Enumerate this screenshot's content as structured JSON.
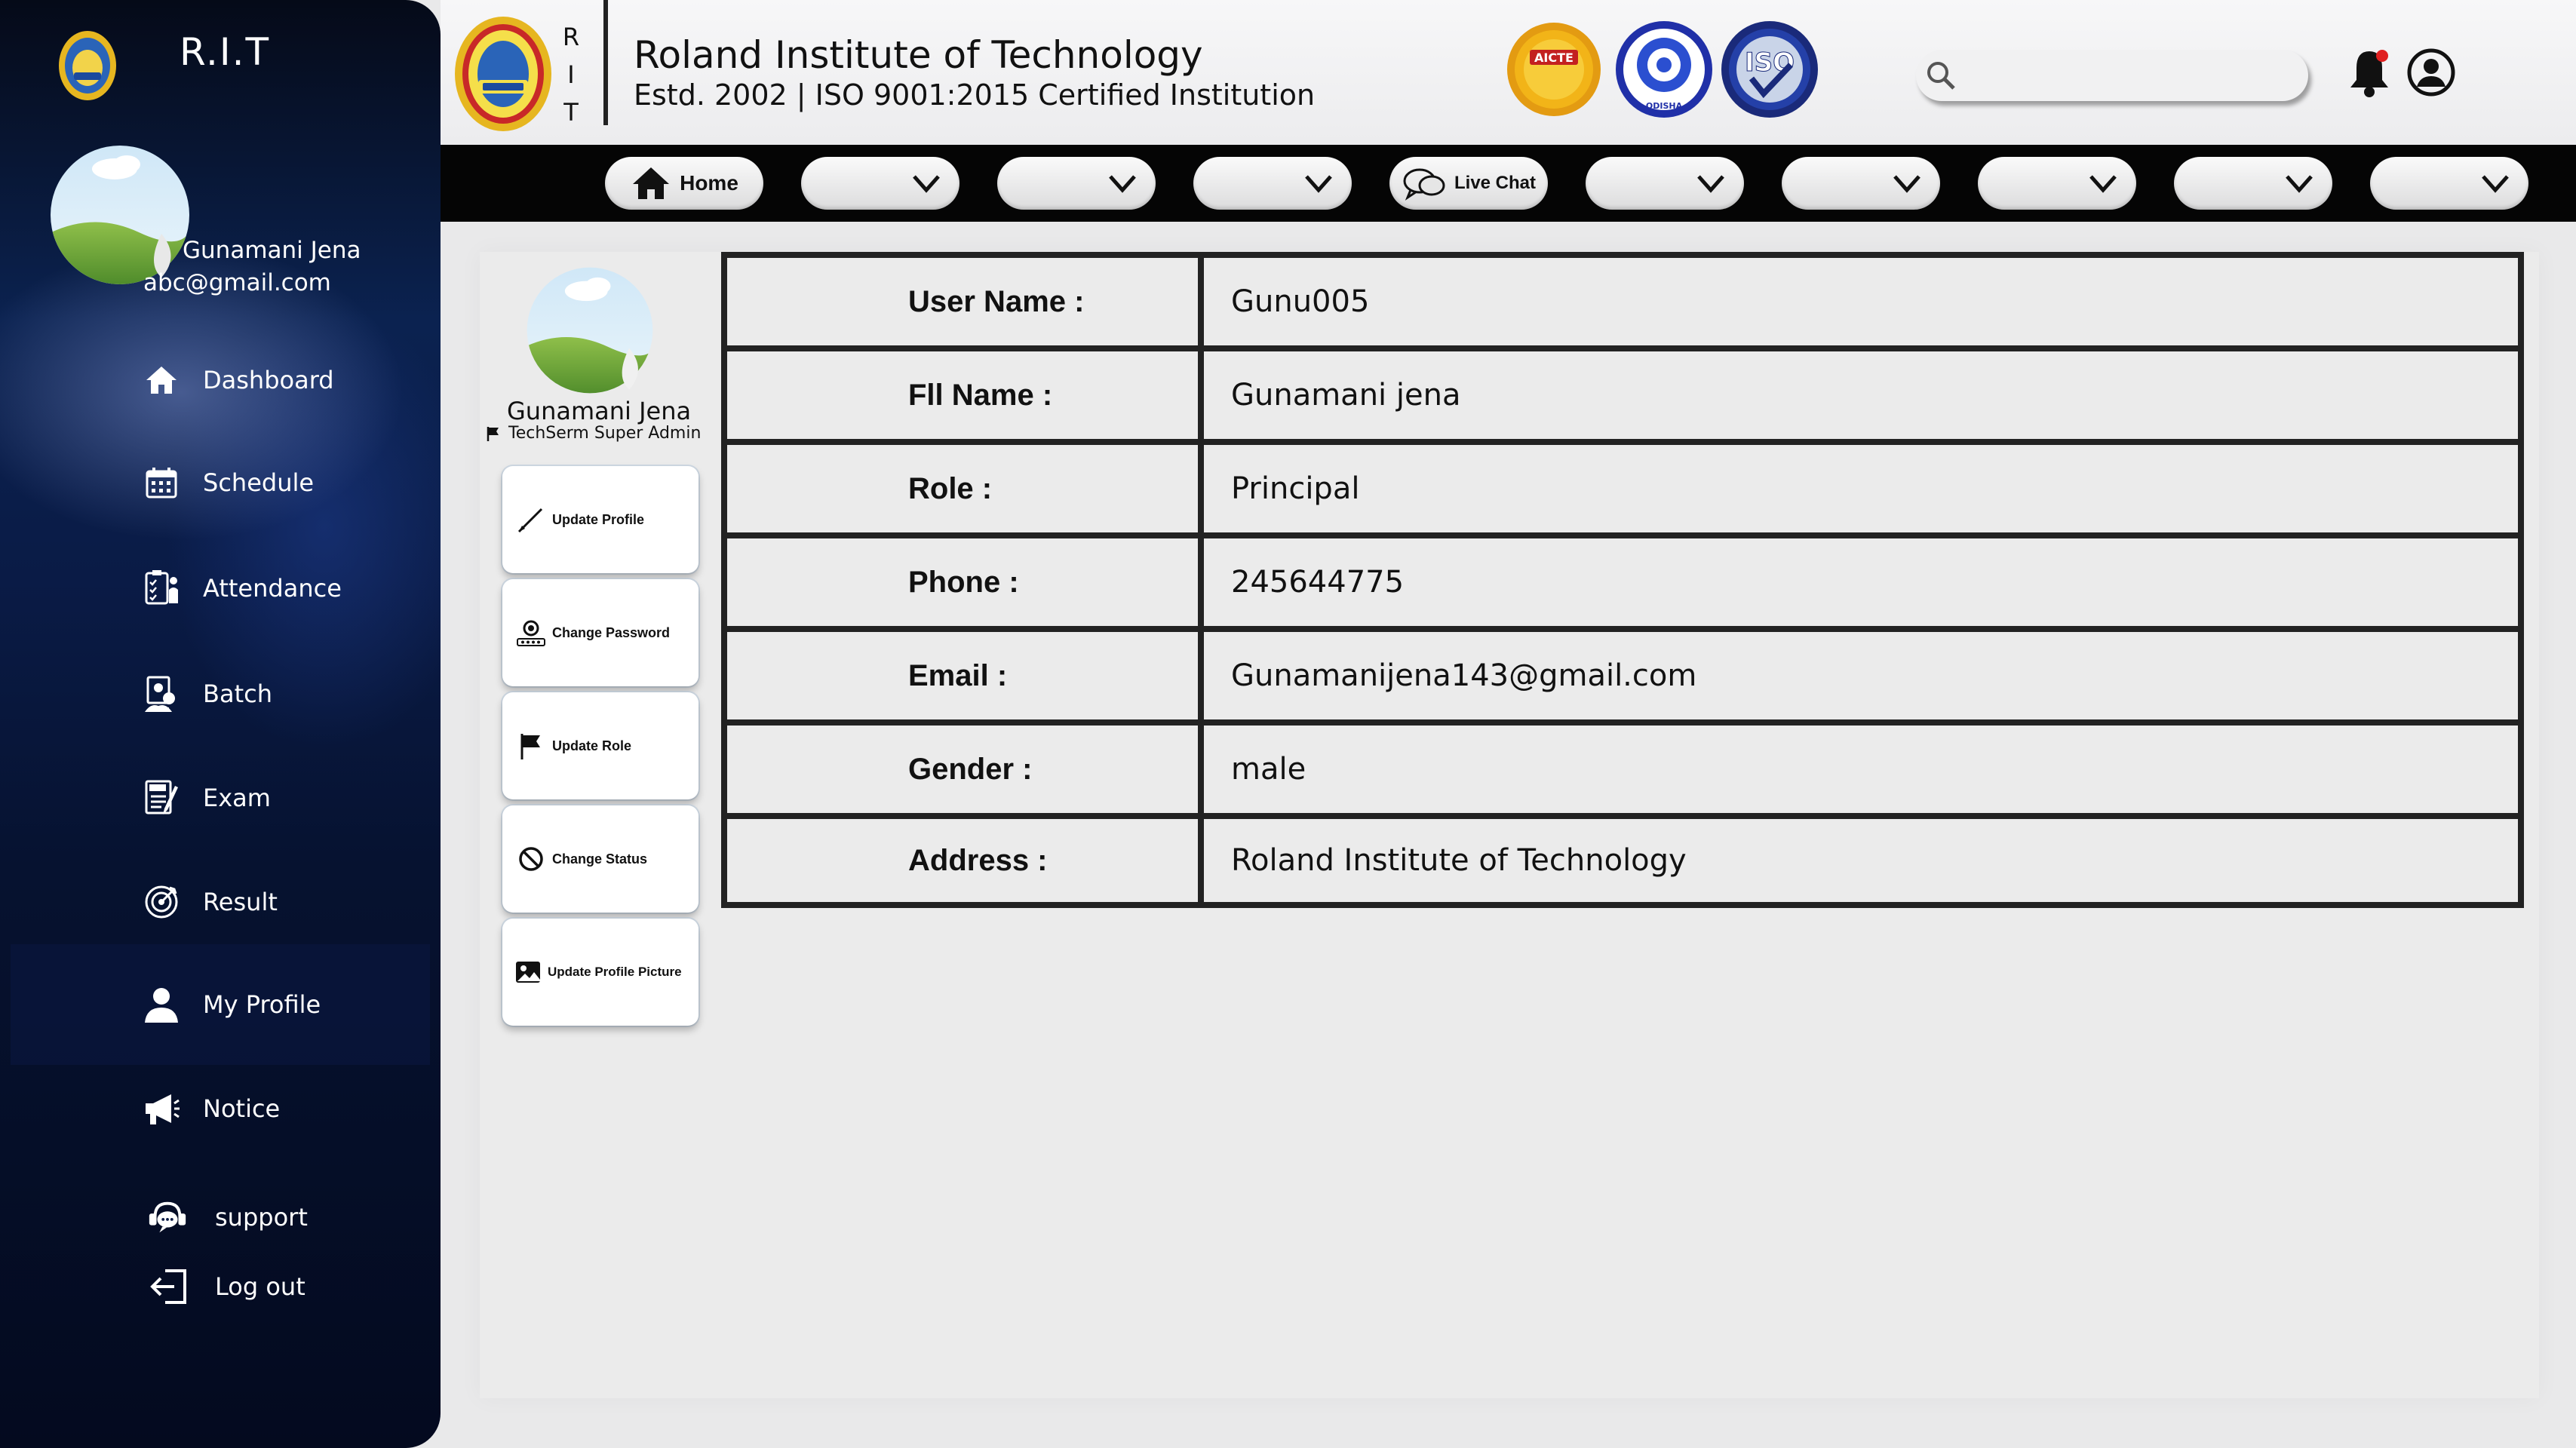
{
  "sidebar": {
    "brand": "R.I.T",
    "user_name": "Gunamani Jena",
    "user_email": "abc@gmail.com",
    "items": [
      {
        "label": "Dashboard",
        "icon": "home-icon"
      },
      {
        "label": "Schedule",
        "icon": "calendar-icon"
      },
      {
        "label": "Attendance",
        "icon": "attendance-icon"
      },
      {
        "label": "Batch",
        "icon": "batch-icon"
      },
      {
        "label": "Exam",
        "icon": "exam-icon"
      },
      {
        "label": "Result",
        "icon": "result-icon"
      },
      {
        "label": "My Profile",
        "icon": "user-icon",
        "active": true
      },
      {
        "label": "Notice",
        "icon": "megaphone-icon"
      },
      {
        "label": "support",
        "icon": "support-icon"
      },
      {
        "label": "Log out",
        "icon": "logout-icon"
      }
    ]
  },
  "header": {
    "rit_letters": [
      "R",
      "I",
      "T"
    ],
    "title": "Roland Institute of Technology",
    "subtitle": "Estd. 2002 | ISO 9001:2015 Certified Institution",
    "badges": [
      "AICTE",
      "ODISHA",
      "ISO"
    ],
    "search_placeholder": ""
  },
  "navbar": {
    "home_label": "Home",
    "livechat_label": "Live Chat",
    "dropdown_count": 8
  },
  "profile": {
    "name": "Gunamani Jena",
    "role": "TechSerm Super Admin",
    "actions": [
      {
        "label": "Update Profile",
        "icon": "pen-icon"
      },
      {
        "label": "Change Password",
        "icon": "password-icon"
      },
      {
        "label": "Update Role",
        "icon": "flag-icon"
      },
      {
        "label": "Change Status",
        "icon": "block-icon"
      },
      {
        "label": "Update Profile Picture",
        "icon": "image-icon"
      }
    ]
  },
  "details": [
    {
      "label": "User Name :",
      "value": "Gunu005"
    },
    {
      "label": "Fll Name :",
      "value": "Gunamani jena"
    },
    {
      "label": "Role :",
      "value": "Principal"
    },
    {
      "label": "Phone :",
      "value": "245644775"
    },
    {
      "label": "Email :",
      "value": "Gunamanijena143@gmail.com"
    },
    {
      "label": "Gender :",
      "value": "male"
    },
    {
      "label": "Address :",
      "value": "Roland Institute of Technology"
    }
  ],
  "colors": {
    "sidebar_dark": "#050a18",
    "sidebar_blue": "#0b2250",
    "navbar": "#050505",
    "table_border": "#222222",
    "notification_dot": "#e02020"
  }
}
